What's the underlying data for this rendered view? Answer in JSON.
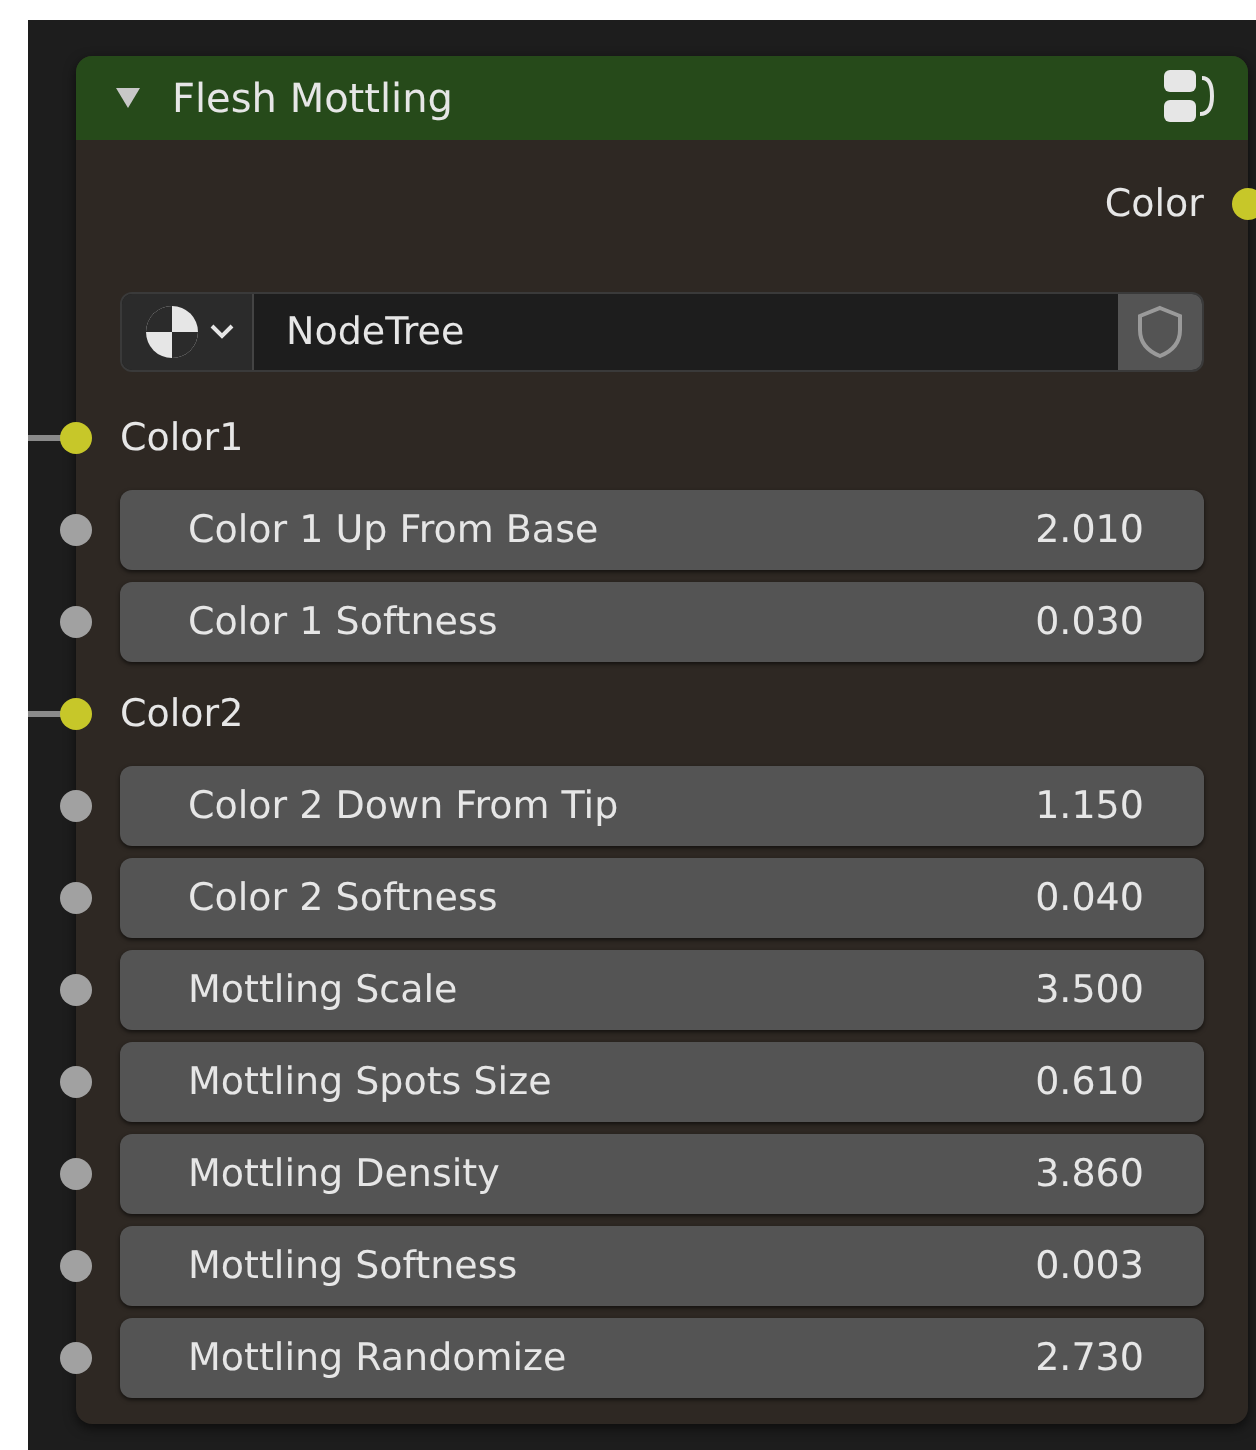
{
  "node": {
    "title": "Flesh Mottling",
    "expanded": true
  },
  "outputs": [
    {
      "label": "Color",
      "kind": "color"
    }
  ],
  "tree_selector": {
    "value": "NodeTree"
  },
  "inputs": [
    {
      "kind": "color",
      "label": "Color1",
      "linked": true
    },
    {
      "kind": "value",
      "label": "Color 1 Up From Base",
      "value": "2.010",
      "linked": false
    },
    {
      "kind": "value",
      "label": "Color 1 Softness",
      "value": "0.030",
      "linked": false
    },
    {
      "kind": "color",
      "label": "Color2",
      "linked": true
    },
    {
      "kind": "value",
      "label": "Color 2 Down From Tip",
      "value": "1.150",
      "linked": false
    },
    {
      "kind": "value",
      "label": "Color 2 Softness",
      "value": "0.040",
      "linked": false
    },
    {
      "kind": "value",
      "label": "Mottling Scale",
      "value": "3.500",
      "linked": false
    },
    {
      "kind": "value",
      "label": "Mottling Spots Size",
      "value": "0.610",
      "linked": false
    },
    {
      "kind": "value",
      "label": "Mottling Density",
      "value": "3.860",
      "linked": false
    },
    {
      "kind": "value",
      "label": "Mottling Softness",
      "value": "0.003",
      "linked": false
    },
    {
      "kind": "value",
      "label": "Mottling Randomize",
      "value": "2.730",
      "linked": false
    }
  ]
}
